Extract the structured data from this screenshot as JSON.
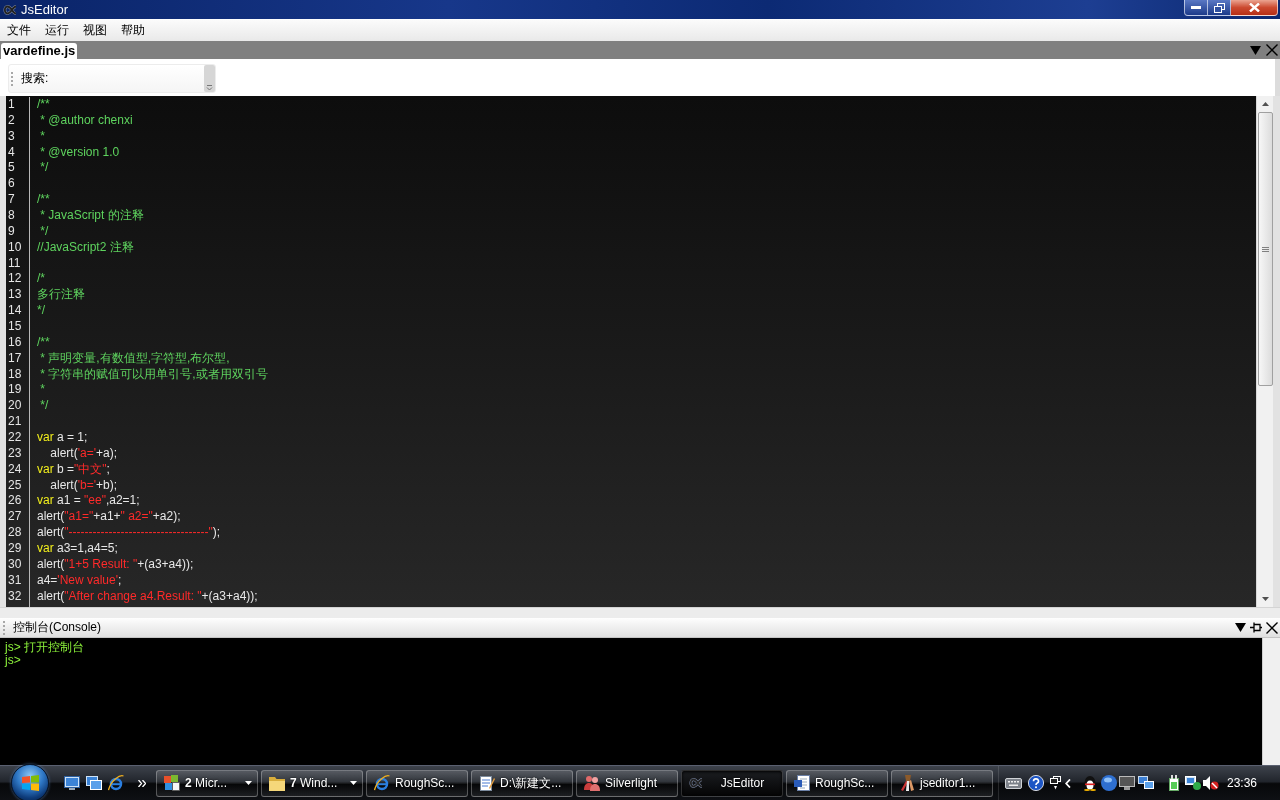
{
  "window": {
    "title": "JsEditor"
  },
  "menu": [
    "文件",
    "运行",
    "视图",
    "帮助"
  ],
  "tabs": [
    {
      "label": "vardefine.js",
      "selected": true
    }
  ],
  "search": {
    "label": "搜索:"
  },
  "editor": {
    "lines": [
      {
        "number": "1",
        "tokens": [
          {
            "kind": "comment",
            "text": "/**"
          }
        ]
      },
      {
        "number": "2",
        "tokens": [
          {
            "kind": "comment",
            "text": " * @author chenxi"
          }
        ]
      },
      {
        "number": "3",
        "tokens": [
          {
            "kind": "comment",
            "text": " *"
          }
        ]
      },
      {
        "number": "4",
        "tokens": [
          {
            "kind": "comment",
            "text": " * @version 1.0"
          }
        ]
      },
      {
        "number": "5",
        "tokens": [
          {
            "kind": "comment",
            "text": " */"
          }
        ]
      },
      {
        "number": "6"
      },
      {
        "number": "7",
        "tokens": [
          {
            "kind": "comment",
            "text": "/**"
          }
        ]
      },
      {
        "number": "8",
        "tokens": [
          {
            "kind": "comment",
            "text": " * JavaScript 的注释"
          }
        ]
      },
      {
        "number": "9",
        "tokens": [
          {
            "kind": "comment",
            "text": " */"
          }
        ]
      },
      {
        "number": "10",
        "tokens": [
          {
            "kind": "comment",
            "text": "//JavaScript2 注释"
          }
        ]
      },
      {
        "number": "11"
      },
      {
        "number": "12",
        "tokens": [
          {
            "kind": "comment",
            "text": "/*"
          }
        ]
      },
      {
        "number": "13",
        "tokens": [
          {
            "kind": "comment",
            "text": "多行注释"
          }
        ]
      },
      {
        "number": "14",
        "tokens": [
          {
            "kind": "comment",
            "text": "*/"
          }
        ]
      },
      {
        "number": "15"
      },
      {
        "number": "16",
        "tokens": [
          {
            "kind": "comment",
            "text": "/**"
          }
        ]
      },
      {
        "number": "17",
        "tokens": [
          {
            "kind": "comment",
            "text": " * 声明变量,有数值型,字符型,布尔型,"
          }
        ]
      },
      {
        "number": "18",
        "tokens": [
          {
            "kind": "comment",
            "text": " * 字符串的赋值可以用单引号,或者用双引号"
          }
        ]
      },
      {
        "number": "19",
        "tokens": [
          {
            "kind": "comment",
            "text": " *"
          }
        ]
      },
      {
        "number": "20",
        "tokens": [
          {
            "kind": "comment",
            "text": " */"
          }
        ]
      },
      {
        "number": "21"
      },
      {
        "number": "22",
        "tokens": [
          {
            "kind": "keyword",
            "text": "var"
          },
          {
            "kind": "plain",
            "text": " a = 1;"
          }
        ]
      },
      {
        "number": "23",
        "tokens": [
          {
            "kind": "plain",
            "text": "    alert("
          },
          {
            "kind": "string",
            "text": "'a='"
          },
          {
            "kind": "plain",
            "text": "+a);"
          }
        ]
      },
      {
        "number": "24",
        "tokens": [
          {
            "kind": "keyword",
            "text": "var"
          },
          {
            "kind": "plain",
            "text": " b ="
          },
          {
            "kind": "string",
            "text": "\"中文\""
          },
          {
            "kind": "plain",
            "text": ";"
          }
        ]
      },
      {
        "number": "25",
        "tokens": [
          {
            "kind": "plain",
            "text": "    alert("
          },
          {
            "kind": "string",
            "text": "'b='"
          },
          {
            "kind": "plain",
            "text": "+b);"
          }
        ]
      },
      {
        "number": "26",
        "tokens": [
          {
            "kind": "keyword",
            "text": "var"
          },
          {
            "kind": "plain",
            "text": " a1 = "
          },
          {
            "kind": "string",
            "text": "\"ee\""
          },
          {
            "kind": "plain",
            "text": ",a2=1;"
          }
        ]
      },
      {
        "number": "27",
        "tokens": [
          {
            "kind": "plain",
            "text": "alert("
          },
          {
            "kind": "string",
            "text": "\"a1=\""
          },
          {
            "kind": "plain",
            "text": "+a1+"
          },
          {
            "kind": "string",
            "text": "\" a2=\""
          },
          {
            "kind": "plain",
            "text": "+a2);"
          }
        ]
      },
      {
        "number": "28",
        "tokens": [
          {
            "kind": "plain",
            "text": "alert("
          },
          {
            "kind": "string",
            "text": "\"-----------------------------------\""
          },
          {
            "kind": "plain",
            "text": ");"
          }
        ]
      },
      {
        "number": "29",
        "tokens": [
          {
            "kind": "keyword",
            "text": "var"
          },
          {
            "kind": "plain",
            "text": " a3=1,a4=5;"
          }
        ]
      },
      {
        "number": "30",
        "tokens": [
          {
            "kind": "plain",
            "text": "alert("
          },
          {
            "kind": "string",
            "text": "\"1+5 Result: \""
          },
          {
            "kind": "plain",
            "text": "+(a3+a4));"
          }
        ]
      },
      {
        "number": "31",
        "tokens": [
          {
            "kind": "plain",
            "text": "a4="
          },
          {
            "kind": "string",
            "text": "'New value'"
          },
          {
            "kind": "plain",
            "text": ";"
          }
        ]
      },
      {
        "number": "32",
        "tokens": [
          {
            "kind": "plain",
            "text": "alert("
          },
          {
            "kind": "string",
            "text": "\"After change a4.Result: \""
          },
          {
            "kind": "plain",
            "text": "+(a3+a4));"
          }
        ]
      }
    ]
  },
  "console": {
    "title": "控制台(Console)",
    "lines": [
      "js> 打开控制台",
      "js>"
    ]
  },
  "taskbar": {
    "tasks": [
      {
        "kind": "office",
        "label": "**2** Micr...",
        "grouped": true,
        "selected": false
      },
      {
        "kind": "folder",
        "label": "**7** Wind...",
        "grouped": true,
        "selected": false
      },
      {
        "kind": "browser",
        "label": "RoughSc...",
        "grouped": false,
        "selected": false
      },
      {
        "kind": "notepad",
        "label": "D:\\新建文...",
        "grouped": false,
        "selected": false
      },
      {
        "kind": "silverlight",
        "label": "Silverlight",
        "grouped": false,
        "selected": false
      },
      {
        "kind": "editor",
        "label": "JsEditor",
        "grouped": false,
        "selected": true
      },
      {
        "kind": "word",
        "label": "RoughSc...",
        "grouped": false,
        "selected": false
      },
      {
        "kind": "archive",
        "label": "jseditor1...",
        "grouped": false,
        "selected": false
      }
    ],
    "clock": "23:36"
  }
}
